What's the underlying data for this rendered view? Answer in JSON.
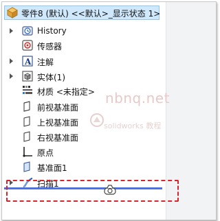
{
  "root": {
    "label": "零件8 (默认) <<默认>_显示状态 1>",
    "icon": "part-icon"
  },
  "items": [
    {
      "label": "History",
      "icon": "history-icon",
      "expandable": true
    },
    {
      "label": "传感器",
      "icon": "sensor-icon",
      "expandable": false
    },
    {
      "label": "注解",
      "icon": "annotation-icon",
      "expandable": true
    },
    {
      "label": "实体(1)",
      "icon": "solid-bodies-icon",
      "expandable": true
    },
    {
      "label": "材质 <未指定>",
      "icon": "material-icon",
      "expandable": false
    },
    {
      "label": "前视基准面",
      "icon": "plane-icon",
      "expandable": false
    },
    {
      "label": "上视基准面",
      "icon": "plane-icon",
      "expandable": false
    },
    {
      "label": "右视基准面",
      "icon": "plane-icon",
      "expandable": false
    },
    {
      "label": "原点",
      "icon": "origin-icon",
      "expandable": false
    },
    {
      "label": "基准面1",
      "icon": "plane-icon",
      "expandable": false
    },
    {
      "label": "扫描1",
      "icon": "sweep-icon",
      "expandable": true
    }
  ],
  "watermark": {
    "line1": "nbnq.net",
    "line2": "solidworks 教程"
  },
  "colors": {
    "selection": "#cfe8fb",
    "drop_indicator": "#4a72e6",
    "highlight_box": "#d9232a"
  }
}
